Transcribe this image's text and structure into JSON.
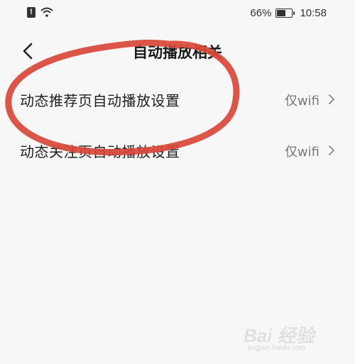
{
  "status_bar": {
    "battery_percent": "66%",
    "battery_level": 0.66,
    "time": "10:58"
  },
  "header": {
    "title": "自动播放相关"
  },
  "settings": [
    {
      "label": "动态推荐页自动播放设置",
      "value": "仅wifi"
    },
    {
      "label": "动态关注页自动播放设置",
      "value": "仅wifi"
    }
  ],
  "watermark": {
    "brand": "Bai 经验",
    "url": "jingyan.baidu.com"
  },
  "colors": {
    "background": "#f7f7f7",
    "annotation": "#d9473a",
    "secondary_text": "#777777"
  }
}
